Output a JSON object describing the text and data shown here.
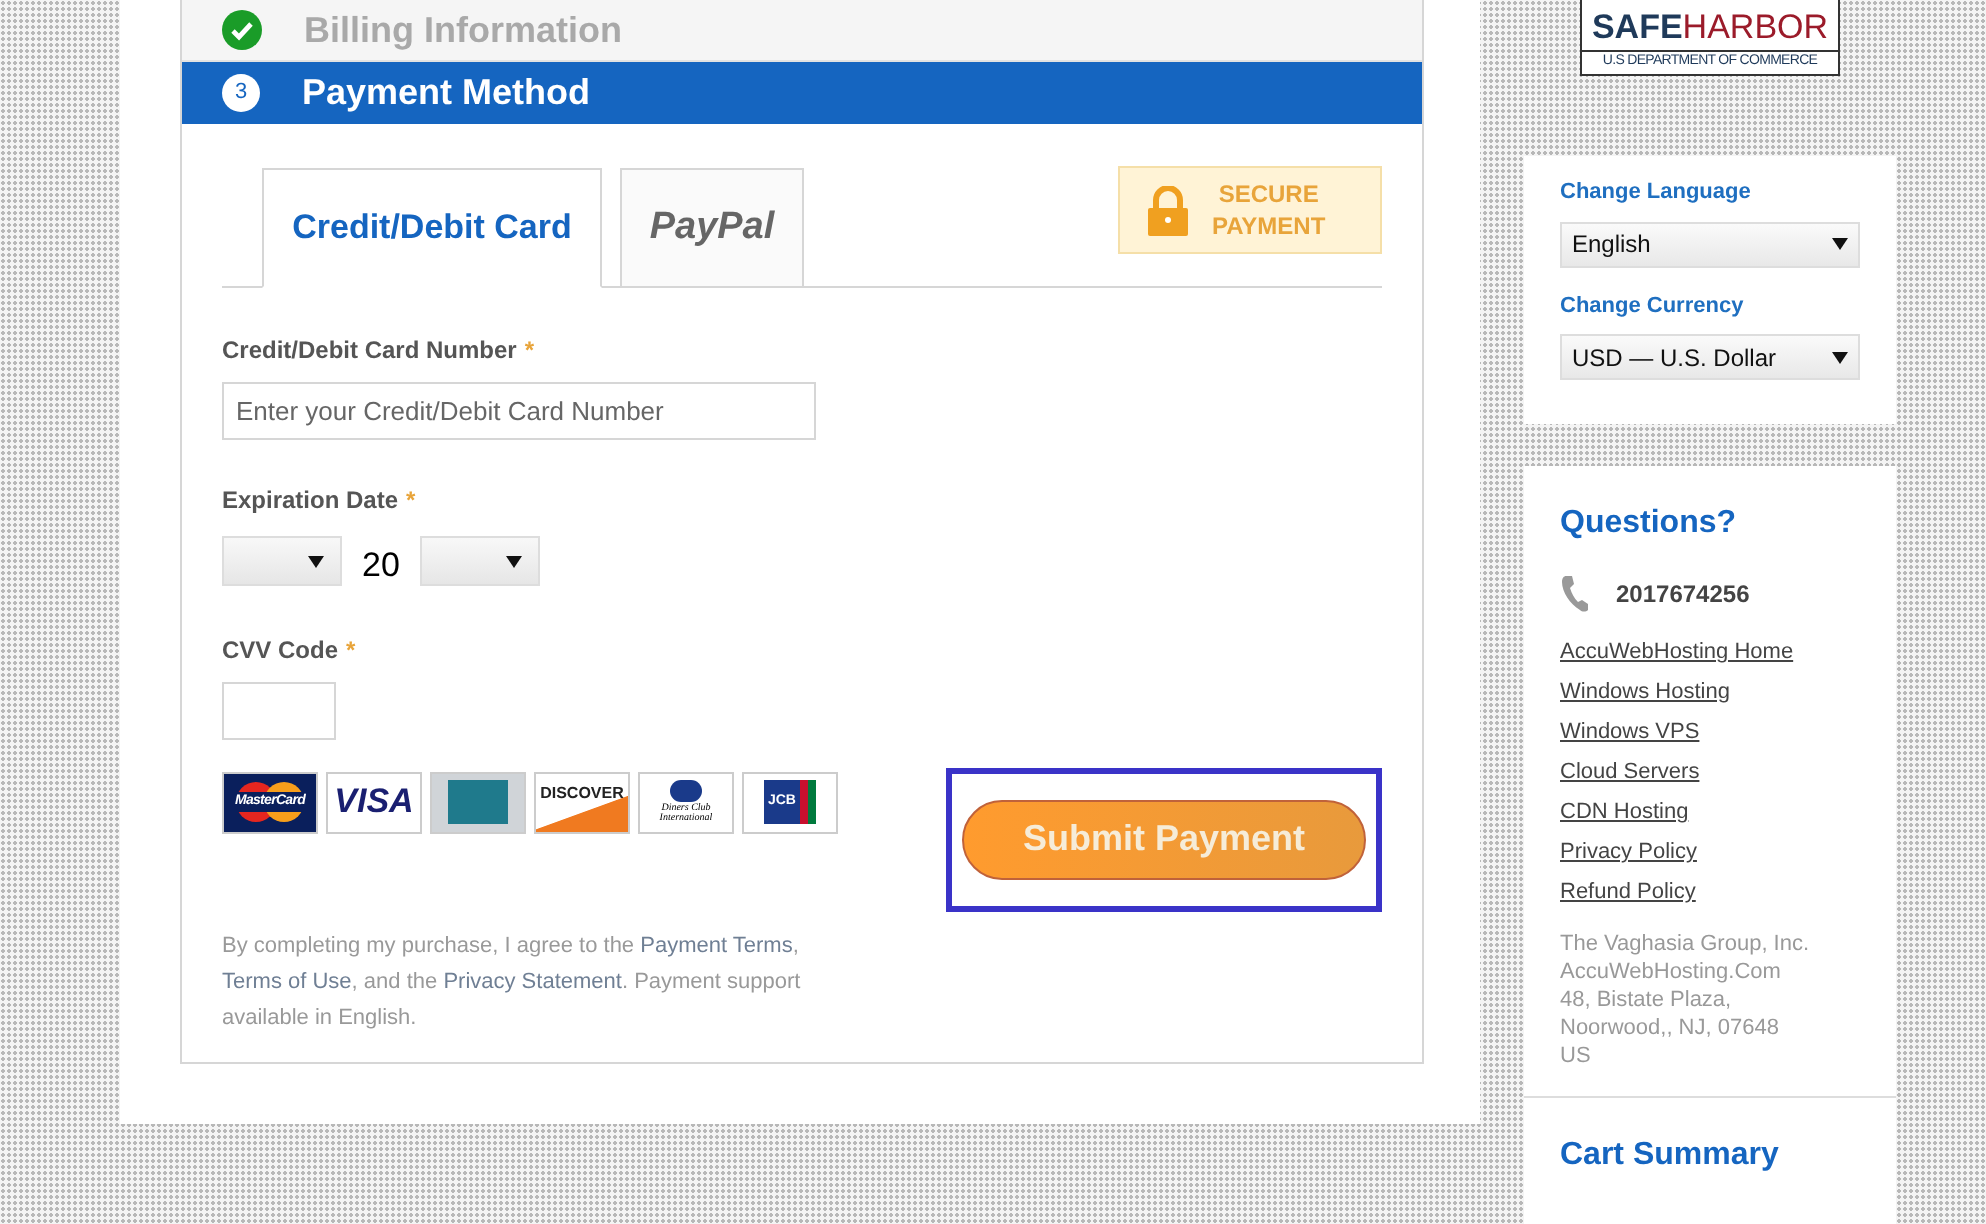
{
  "steps": [
    {
      "label": "Billing Information",
      "completed": true,
      "selected": false
    },
    {
      "label": "Payment Method",
      "number": "3",
      "completed": false,
      "selected": true
    }
  ],
  "tabs": [
    {
      "kind": "text",
      "label": "Credit/Debit Card",
      "selected": true
    },
    {
      "kind": "paypal",
      "label": "PayPal",
      "selected": false
    }
  ],
  "secure_badge": {
    "lines": [
      "SECURE",
      "PAYMENT"
    ]
  },
  "card_number": {
    "label": "Credit/Debit Card Number",
    "required": "*",
    "placeholder": "Enter your Credit/Debit Card Number"
  },
  "expiration": {
    "label": "Expiration Date",
    "required": "*",
    "year_prefix": "20"
  },
  "cvv": {
    "label": "CVV Code",
    "required": "*"
  },
  "cards": [
    {
      "kind": "mastercard",
      "label": "MasterCard"
    },
    {
      "kind": "visa",
      "label": "VISA"
    },
    {
      "kind": "amex"
    },
    {
      "kind": "discover",
      "label": "DISCOVER"
    },
    {
      "kind": "diners",
      "label": "Diners Club International"
    },
    {
      "kind": "jcb",
      "label": "JCB"
    }
  ],
  "submit": {
    "label": "Submit Payment",
    "highlighted": true
  },
  "terms": {
    "before": "By completing my purchase, I agree to the",
    "link1": "Payment Terms",
    "mid1": ",",
    "link2": "Terms of Use",
    "mid2": ", and the",
    "link3": "Privacy Statement",
    "after": ". Payment support available in English."
  },
  "safeharbor": {
    "title_bold": "SAFE",
    "title_rest": "HARBOR",
    "subtitle": "U.S DEPARTMENT OF COMMERCE"
  },
  "language": {
    "label": "Change Language",
    "value": "English"
  },
  "currency": {
    "label": "Change Currency",
    "value": "USD — U.S. Dollar"
  },
  "questions": {
    "title": "Questions?",
    "phone": "2017674256",
    "links": [
      "AccuWebHosting Home",
      "Windows Hosting",
      "Windows VPS",
      "Cloud Servers",
      "CDN Hosting",
      "Privacy Policy",
      "Refund Policy"
    ],
    "address": [
      "The Vaghasia Group, Inc.",
      "AccuWebHosting.Com",
      "48, Bistate Plaza,",
      "Noorwood,, NJ, 07648",
      "US"
    ]
  },
  "cart_summary": {
    "title": "Cart Summary"
  }
}
